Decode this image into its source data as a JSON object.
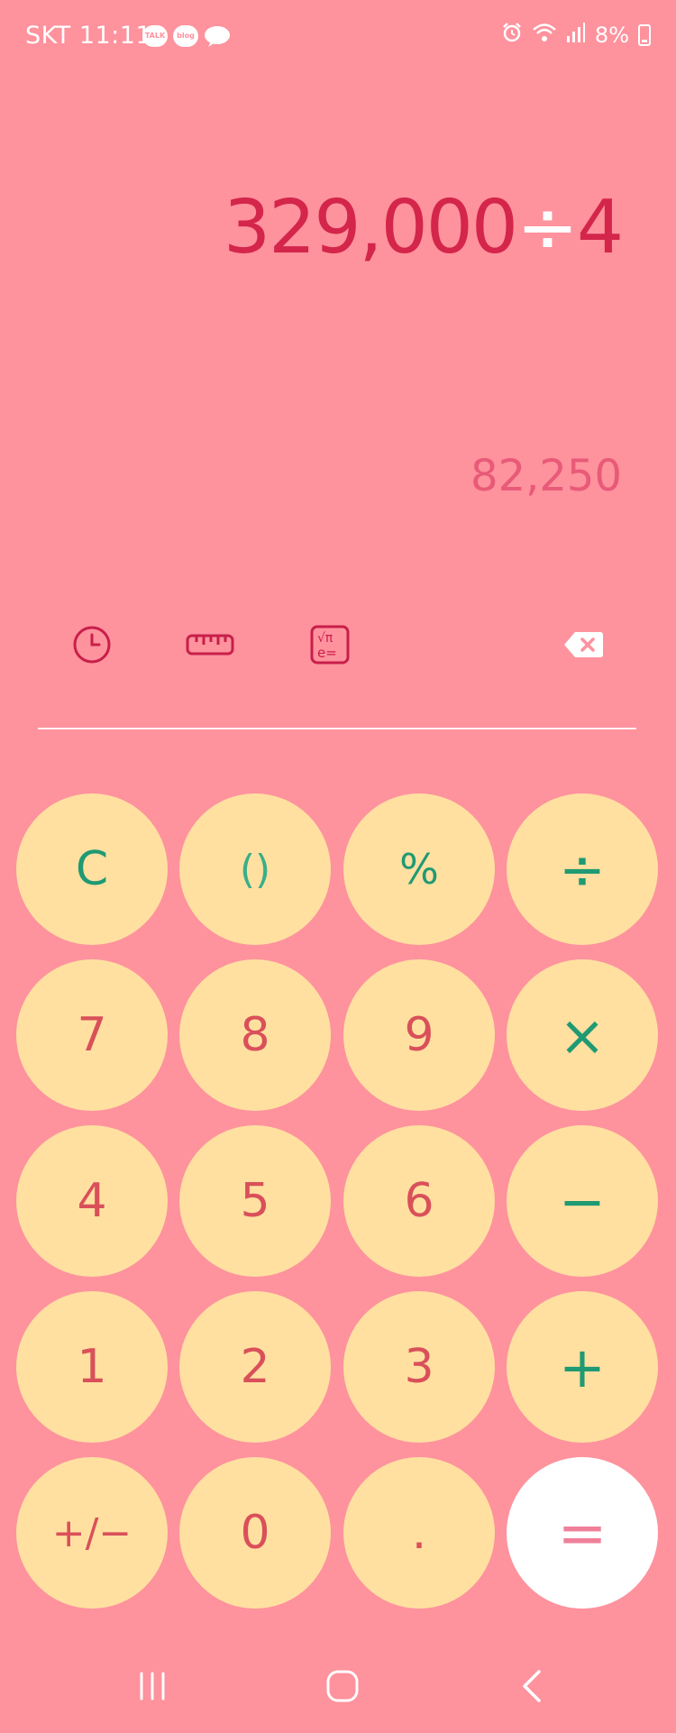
{
  "status_bar": {
    "carrier_time": "SKT 11:11",
    "notif_talk": "TALK",
    "notif_blog": "blog",
    "battery": "8%"
  },
  "display": {
    "expression_number": "329,000",
    "expression_operator": "÷",
    "expression_operand": "4",
    "result": "82,250"
  },
  "toolbar": {
    "icons": [
      "history-icon",
      "unit-converter-icon",
      "scientific-mode-icon",
      "backspace-icon"
    ]
  },
  "keypad": {
    "row1": [
      "C",
      "()",
      "%",
      "÷"
    ],
    "row2": [
      "7",
      "8",
      "9",
      "×"
    ],
    "row3": [
      "4",
      "5",
      "6",
      "−"
    ],
    "row4": [
      "1",
      "2",
      "3",
      "+"
    ],
    "row5": [
      "+/−",
      "0",
      ".",
      "="
    ]
  },
  "colors": {
    "background": "#fe929d",
    "key": "#ffe0a1",
    "equals_key": "#ffffff",
    "expression": "#d4254a",
    "digit": "#d9505a",
    "operator": "#1f9a73"
  }
}
